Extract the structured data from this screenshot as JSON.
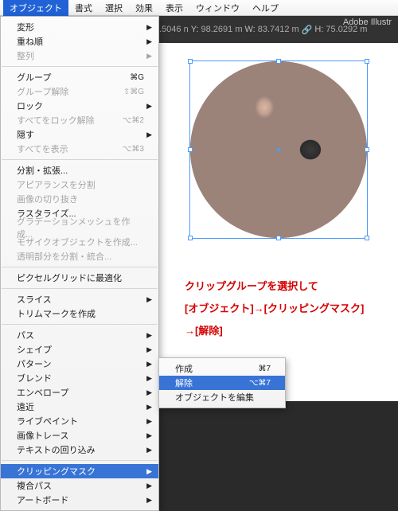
{
  "menubar": {
    "items": [
      "オブジェクト",
      "書式",
      "選択",
      "効果",
      "表示",
      "ウィンドウ",
      "ヘルプ"
    ],
    "activeIndex": 0
  },
  "appTitle": "Adobe Illustr",
  "toolbar": {
    "x_lbl": ".5046 n",
    "y_lbl": "Y:",
    "y_val": "98.2691 m",
    "w_lbl": "W:",
    "w_val": "83.7412 m",
    "h_lbl": "H:",
    "h_val": "75.0292 m",
    "link": "🔗"
  },
  "objectMenu": {
    "groups": [
      [
        {
          "label": "変形",
          "arrow": true
        },
        {
          "label": "重ね順",
          "arrow": true
        },
        {
          "label": "整列",
          "arrow": true,
          "disabled": true
        }
      ],
      [
        {
          "label": "グループ",
          "shortcut": "⌘G"
        },
        {
          "label": "グループ解除",
          "shortcut": "⇧⌘G",
          "disabled": true
        },
        {
          "label": "ロック",
          "arrow": true
        },
        {
          "label": "すべてをロック解除",
          "shortcut": "⌥⌘2",
          "disabled": true
        },
        {
          "label": "隠す",
          "arrow": true
        },
        {
          "label": "すべてを表示",
          "shortcut": "⌥⌘3",
          "disabled": true
        }
      ],
      [
        {
          "label": "分割・拡張..."
        },
        {
          "label": "アピアランスを分割",
          "disabled": true
        },
        {
          "label": "画像の切り抜き",
          "disabled": true
        },
        {
          "label": "ラスタライズ..."
        },
        {
          "label": "グラデーションメッシュを作成...",
          "disabled": true
        },
        {
          "label": "モザイクオブジェクトを作成...",
          "disabled": true
        },
        {
          "label": "透明部分を分割・統合...",
          "disabled": true
        }
      ],
      [
        {
          "label": "ピクセルグリッドに最適化"
        }
      ],
      [
        {
          "label": "スライス",
          "arrow": true
        },
        {
          "label": "トリムマークを作成"
        }
      ],
      [
        {
          "label": "パス",
          "arrow": true
        },
        {
          "label": "シェイプ",
          "arrow": true
        },
        {
          "label": "パターン",
          "arrow": true
        },
        {
          "label": "ブレンド",
          "arrow": true
        },
        {
          "label": "エンベロープ",
          "arrow": true
        },
        {
          "label": "遠近",
          "arrow": true
        },
        {
          "label": "ライブペイント",
          "arrow": true
        },
        {
          "label": "画像トレース",
          "arrow": true
        },
        {
          "label": "テキストの回り込み",
          "arrow": true
        }
      ],
      [
        {
          "label": "クリッピングマスク",
          "arrow": true,
          "highlight": true
        },
        {
          "label": "複合パス",
          "arrow": true
        },
        {
          "label": "アートボード",
          "arrow": true
        }
      ]
    ]
  },
  "submenu": {
    "items": [
      {
        "label": "作成",
        "shortcut": "⌘7"
      },
      {
        "label": "解除",
        "shortcut": "⌥⌘7",
        "highlight": true
      },
      {
        "label": "オブジェクトを編集"
      }
    ]
  },
  "annotation": {
    "l1": "クリップグループを選択して",
    "l2": "[オブジェクト]→[クリッピングマスク]",
    "l3": "→[解除]"
  }
}
